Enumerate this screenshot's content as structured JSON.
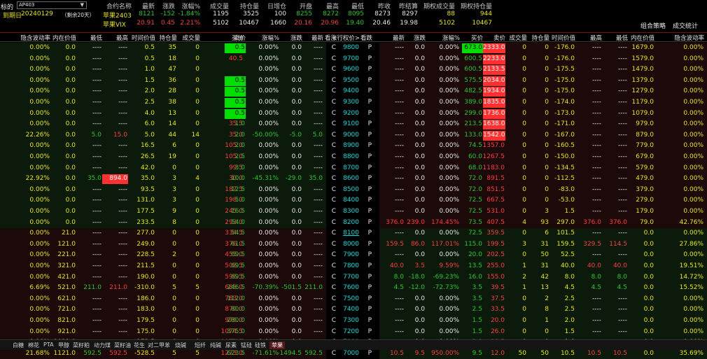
{
  "top": {
    "label_analysis": "标的",
    "product": "苹果",
    "contract_select": "AP403",
    "expiry_label": "到期日",
    "expiry_date": "20240129",
    "remaining": "（剩余20天）",
    "quote_headers": [
      "合约名称",
      "最新",
      "涨跌",
      "涨幅%",
      "成交量",
      "持仓量",
      "日增仓",
      "开盘",
      "最高",
      "最低",
      "昨收",
      "昨结算",
      "期权成交量",
      "期权持仓量"
    ],
    "quote_rows": [
      [
        "苹果2403",
        "8121",
        "-152",
        "-1.84%",
        "1195",
        "3525",
        "100",
        "8255",
        "8272",
        "8095",
        "8273",
        "8297",
        "88",
        "944"
      ],
      [
        "苹果VIX",
        "20.91",
        "0.45",
        "2.21%",
        "5102",
        "10467",
        "1660",
        "20.16",
        "20.96",
        "19.40",
        "20.46",
        "19.98",
        "5102",
        "10467"
      ]
    ],
    "btn_combo": "组合策略",
    "btn_stats": "成交统计"
  },
  "columns": {
    "call": [
      "隐含波动率",
      "内在价值",
      "最低",
      "最高",
      "时间价值",
      "持仓量",
      "成交量",
      "买价",
      "卖价",
      "涨幅%",
      "涨跌",
      "最新"
    ],
    "mid": [
      "看涨",
      "<行权价>",
      "看跌"
    ],
    "put": [
      "最新",
      "涨跌",
      "涨幅%",
      "买价",
      "卖价",
      "成交量",
      "持仓量",
      "时间价值",
      "最高",
      "最低",
      "内在价值",
      "隐含波动率"
    ]
  },
  "rows": [
    {
      "c": [
        "0.00%",
        "0.0",
        "----",
        "----",
        "0.5",
        "35",
        "0",
        "105.0",
        "0.5",
        "0.00%",
        "0.0",
        "----"
      ],
      "k": [
        "C",
        "9800",
        "P"
      ],
      "p": [
        "----",
        "0.0",
        "0.00%",
        "673.0",
        "2333.0",
        "0",
        "0",
        "-176.0",
        "----",
        "----",
        "1679.0",
        "0.00%"
      ]
    },
    {
      "c": [
        "0.00%",
        "0.0",
        "----",
        "----",
        "0.5",
        "18",
        "0",
        "40.5",
        "",
        "0.00%",
        "0.0",
        "----"
      ],
      "k": [
        "C",
        "9700",
        "P"
      ],
      "p": [
        "----",
        "0.0",
        "0.00%",
        "600.5",
        "2233.0",
        "0",
        "0",
        "-176.0",
        "----",
        "----",
        "1579.0",
        "0.00%"
      ]
    },
    {
      "c": [
        "0.00%",
        "0.0",
        "----",
        "----",
        "1.0",
        "47",
        "0",
        "",
        "",
        "0.00%",
        "0.0",
        "----"
      ],
      "k": [
        "C",
        "9600",
        "P"
      ],
      "p": [
        "----",
        "0.0",
        "0.00%",
        "600.5",
        "2133.5",
        "0",
        "0",
        "-175.5",
        "----",
        "----",
        "1479.0",
        "0.00%"
      ]
    },
    {
      "c": [
        "0.00%",
        "0.0",
        "----",
        "----",
        "1.5",
        "36",
        "0",
        "40.5",
        "0.5",
        "0.00%",
        "0.0",
        "----"
      ],
      "k": [
        "C",
        "9500",
        "P"
      ],
      "p": [
        "----",
        "0.0",
        "0.00%",
        "575.5",
        "2034.0",
        "0",
        "0",
        "-175.0",
        "----",
        "----",
        "1379.0",
        "0.00%"
      ]
    },
    {
      "c": [
        "0.00%",
        "0.0",
        "----",
        "----",
        "2.0",
        "28",
        "0",
        "35.5",
        "0.5",
        "0.00%",
        "0.0",
        "----"
      ],
      "k": [
        "C",
        "9400",
        "P"
      ],
      "p": [
        "----",
        "0.0",
        "0.00%",
        "482.5",
        "1934.0",
        "0",
        "0",
        "-175.0",
        "----",
        "----",
        "1279.0",
        "0.00%"
      ]
    },
    {
      "c": [
        "0.00%",
        "0.0",
        "----",
        "----",
        "2.5",
        "38",
        "0",
        "110.5",
        "0.5",
        "0.00%",
        "0.0",
        "----"
      ],
      "k": [
        "C",
        "9300",
        "P"
      ],
      "p": [
        "----",
        "0.0",
        "0.00%",
        "389.0",
        "1835.0",
        "0",
        "0",
        "-174.0",
        "----",
        "----",
        "1179.0",
        "0.00%"
      ]
    },
    {
      "c": [
        "0.00%",
        "0.0",
        "----",
        "----",
        "4.0",
        "13",
        "0",
        "35.0",
        "0.5",
        "0.00%",
        "0.0",
        "----"
      ],
      "k": [
        "C",
        "9200",
        "P"
      ],
      "p": [
        "----",
        "0.0",
        "0.00%",
        "299.0",
        "1736.0",
        "0",
        "0",
        "-173.0",
        "----",
        "----",
        "1079.0",
        "0.00%"
      ]
    },
    {
      "c": [
        "0.00%",
        "0.0",
        "----",
        "----",
        "6.0",
        "14",
        "0",
        "35.5",
        "1.0",
        "0.00%",
        "0.0",
        "----"
      ],
      "k": [
        "C",
        "9100",
        "P"
      ],
      "p": [
        "----",
        "0.0",
        "0.00%",
        "213.5",
        "1638.0",
        "0",
        "0",
        "-171.0",
        "----",
        "----",
        "979.0",
        "0.00%"
      ]
    },
    {
      "c": [
        "22.26%",
        "0.0",
        "5.0",
        "15.0",
        "5.0",
        "44",
        "14",
        "35.0",
        "2.0",
        "-50.00%",
        "-5.0",
        "5.0"
      ],
      "k": [
        "C",
        "9000",
        "P"
      ],
      "p": [
        "----",
        "0.0",
        "0.00%",
        "133.0",
        "1542.0",
        "0",
        "0",
        "-167.0",
        "----",
        "----",
        "879.0",
        "0.00%"
      ]
    },
    {
      "c": [
        "0.00%",
        "0.0",
        "----",
        "----",
        "16.5",
        "6",
        "0",
        "105.0",
        "2.0",
        "0.00%",
        "0.0",
        "----"
      ],
      "k": [
        "C",
        "8900",
        "P"
      ],
      "p": [
        "----",
        "0.0",
        "0.00%",
        "74.5",
        "1357.0",
        "0",
        "0",
        "-160.5",
        "----",
        "----",
        "779.0",
        "0.00%"
      ]
    },
    {
      "c": [
        "0.00%",
        "0.0",
        "----",
        "----",
        "26.5",
        "19",
        "0",
        "105.0",
        "2.5",
        "0.00%",
        "0.0",
        "----"
      ],
      "k": [
        "C",
        "8800",
        "P"
      ],
      "p": [
        "----",
        "0.0",
        "0.00%",
        "60.0",
        "1267.5",
        "0",
        "0",
        "-150.0",
        "----",
        "----",
        "679.0",
        "0.00%"
      ]
    },
    {
      "c": [
        "0.00%",
        "0.0",
        "----",
        "----",
        "42.0",
        "0",
        "0",
        "99.5",
        "3.0",
        "0.00%",
        "0.0",
        "----"
      ],
      "k": [
        "C",
        "8700",
        "P"
      ],
      "p": [
        "----",
        "0.0",
        "0.00%",
        "68.0",
        "1183.0",
        "0",
        "0",
        "-134.5",
        "----",
        "----",
        "579.0",
        "0.00%"
      ]
    },
    {
      "c": [
        "22.92%",
        "0.0",
        "35.0",
        "894.0",
        "35.0",
        "3",
        "4",
        "30.0",
        "10.0",
        "-45.31%",
        "-29.0",
        "35.0"
      ],
      "k": [
        "C",
        "8600",
        "P"
      ],
      "p": [
        "----",
        "0.0",
        "0.00%",
        "72.0",
        "891.5",
        "0",
        "0",
        "-112.5",
        "----",
        "----",
        "479.0",
        "0.00%"
      ]
    },
    {
      "c": [
        "0.00%",
        "0.0",
        "----",
        "----",
        "93.5",
        "3",
        "0",
        "187.5",
        "12.5",
        "0.00%",
        "0.0",
        "----"
      ],
      "k": [
        "C",
        "8500",
        "P"
      ],
      "p": [
        "----",
        "0.0",
        "0.00%",
        "72.0",
        "851.5",
        "0",
        "0",
        "-83.0",
        "----",
        "----",
        "379.0",
        "0.00%"
      ]
    },
    {
      "c": [
        "0.00%",
        "0.0",
        "----",
        "----",
        "131.0",
        "3",
        "0",
        "198.0",
        "5.0",
        "0.00%",
        "0.0",
        "----"
      ],
      "k": [
        "C",
        "8400",
        "P"
      ],
      "p": [
        "----",
        "0.0",
        "0.00%",
        "72.5",
        "667.5",
        "0",
        "0",
        "-53.0",
        "----",
        "----",
        "279.0",
        "0.00%"
      ]
    },
    {
      "c": [
        "0.00%",
        "0.0",
        "----",
        "----",
        "177.5",
        "9",
        "0",
        "245.0",
        "16.5",
        "0.00%",
        "0.0",
        "----"
      ],
      "k": [
        "C",
        "8300",
        "P"
      ],
      "p": [
        "----",
        "0.0",
        "0.00%",
        "72.5",
        "531.0",
        "0",
        "3",
        "1.5",
        "----",
        "----",
        "179.0",
        "0.00%"
      ]
    },
    {
      "c": [
        "0.00%",
        "0.0",
        "----",
        "----",
        "233.5",
        "8",
        "0",
        "293.0",
        "54.0",
        "0.00%",
        "0.0",
        "----"
      ],
      "k": [
        "C",
        "8200",
        "P"
      ],
      "p": [
        "376.0",
        "239.0",
        "174.45%",
        "73.5",
        "407.5",
        "4",
        "93",
        "297.0",
        "376.0",
        "376.0",
        "79.0",
        "42.76%"
      ]
    },
    {
      "c": [
        "0.00%",
        "21.0",
        "----",
        "----",
        "277.0",
        "0",
        "0",
        "334.5",
        "54.5",
        "0.00%",
        "0.0",
        "----"
      ],
      "k": [
        "C",
        "8100",
        "P"
      ],
      "p": [
        "----",
        "0.0",
        "0.00%",
        "72.5",
        "359.5",
        "0",
        "6",
        "101.5",
        "----",
        "----",
        "0.0",
        "0.00%"
      ]
    },
    {
      "c": [
        "0.00%",
        "121.0",
        "----",
        "----",
        "249.0",
        "0",
        "0",
        "376.0",
        "61.5",
        "0.00%",
        "0.0",
        "----"
      ],
      "k": [
        "C",
        "8000",
        "P"
      ],
      "p": [
        "159.5",
        "86.0",
        "117.01%",
        "115.0",
        "199.5",
        "3",
        "31",
        "159.5",
        "329.5",
        "114.5",
        "0.0",
        "27.86%"
      ]
    },
    {
      "c": [
        "0.00%",
        "221.0",
        "----",
        "----",
        "228.5",
        "2",
        "0",
        "455.0",
        "69.5",
        "0.00%",
        "0.0",
        "----"
      ],
      "k": [
        "C",
        "7900",
        "P"
      ],
      "p": [
        "----",
        "0.0",
        "0.00%",
        "20.0",
        "202.5",
        "0",
        "50",
        "52.5",
        "----",
        "----",
        "0.0",
        "0.00%"
      ]
    },
    {
      "c": [
        "0.00%",
        "321.0",
        "----",
        "----",
        "211.5",
        "0",
        "0",
        "508.5",
        "69.5",
        "0.00%",
        "0.0",
        "----"
      ],
      "k": [
        "C",
        "7800",
        "P"
      ],
      "p": [
        "40.0",
        "3.5",
        "9.59%",
        "13.5",
        "255.0",
        "1",
        "31",
        "40.0",
        "40.0",
        "40.0",
        "0.0",
        "19.51%"
      ]
    },
    {
      "c": [
        "0.00%",
        "421.0",
        "----",
        "----",
        "190.0",
        "0",
        "0",
        "596.5",
        "69.5",
        "0.00%",
        "0.0",
        "----"
      ],
      "k": [
        "C",
        "7700",
        "P"
      ],
      "p": [
        "8.0",
        "-18.0",
        "-69.23%",
        "16.0",
        "155.0",
        "2",
        "42",
        "8.0",
        "8.0",
        "8.0",
        "0.0",
        "14.72%"
      ]
    },
    {
      "c": [
        "6.69%",
        "521.0",
        "211.0",
        "211.0",
        "-310.0",
        "5",
        "5",
        "688.0",
        "246.5",
        "-70.39%",
        "-501.5",
        "211.0"
      ],
      "k": [
        "C",
        "7600",
        "P"
      ],
      "p": [
        "4.5",
        "-12.0",
        "-72.73%",
        "3.5",
        "39.5",
        "1",
        "13",
        "4.5",
        "4.5",
        "4.5",
        "0.0",
        "15.52%"
      ]
    },
    {
      "c": [
        "0.00%",
        "621.0",
        "----",
        "----",
        "186.0",
        "0",
        "0",
        "783.0",
        "112.0",
        "0.00%",
        "0.0",
        "----"
      ],
      "k": [
        "C",
        "7500",
        "P"
      ],
      "p": [
        "----",
        "0.0",
        "0.00%",
        "3.5",
        "37.5",
        "0",
        "2",
        "2.5",
        "----",
        "----",
        "0.0",
        "0.00%"
      ]
    },
    {
      "c": [
        "0.00%",
        "721.0",
        "----",
        "----",
        "183.0",
        "0",
        "0",
        "870.0",
        "80.0",
        "0.00%",
        "0.0",
        "----"
      ],
      "k": [
        "C",
        "7400",
        "P"
      ],
      "p": [
        "----",
        "0.0",
        "0.00%",
        "2.5",
        "33.5",
        "0",
        "8",
        "2.5",
        "----",
        "----",
        "0.0",
        "0.00%"
      ]
    },
    {
      "c": [
        "0.00%",
        "821.0",
        "----",
        "----",
        "179.5",
        "0",
        "0",
        "976.0",
        "280.0",
        "0.00%",
        "0.0",
        "----"
      ],
      "k": [
        "C",
        "7300",
        "P"
      ],
      "p": [
        "----",
        "0.0",
        "0.00%",
        "1.5",
        "20.0",
        "0",
        "1",
        "2.0",
        "----",
        "----",
        "0.0",
        "0.00%"
      ]
    },
    {
      "c": [
        "0.00%",
        "921.0",
        "----",
        "----",
        "175.0",
        "0",
        "0",
        "1074.5",
        "375.0",
        "0.00%",
        "0.0",
        "----"
      ],
      "k": [
        "C",
        "7200",
        "P"
      ],
      "p": [
        "----",
        "0.0",
        "0.00%",
        "1.5",
        "26.0",
        "0",
        "0",
        "1.5",
        "----",
        "----",
        "0.0",
        "0.00%"
      ]
    },
    {
      "c": [
        "0.00%",
        "1021.0",
        "----",
        "----",
        "173.5",
        "0",
        "0",
        "1173.5",
        "470.0",
        "0.00%",
        "0.0",
        "----"
      ],
      "k": [
        "C",
        "7100",
        "P"
      ],
      "p": [
        "----",
        "0.0",
        "0.00%",
        "1.0",
        "20.5",
        "0",
        "0",
        "1.0",
        "----",
        "----",
        "0.0",
        "0.00%"
      ]
    },
    {
      "c": [
        "21.68%",
        "1121.0",
        "592.5",
        "592.5",
        "-528.5",
        "5",
        "5",
        "1273.0",
        "623.5",
        "-71.61%",
        "-1494.5",
        "592.5"
      ],
      "k": [
        "C",
        "7000",
        "P"
      ],
      "p": [
        "10.5",
        "9.5",
        "950.00%",
        "9.5",
        "12.0",
        "50",
        "50",
        "10.5",
        "10.5",
        "10.5",
        "0.0",
        "35.69%"
      ]
    }
  ],
  "tabs": [
    "白糖",
    "棉花",
    "PTA",
    "甲醇",
    "菜籽粕",
    "动力煤",
    "菜籽油",
    "花生",
    "对二甲苯",
    "烧碱",
    "短纤",
    "纯碱",
    "尿素",
    "锰硅",
    "硅铁",
    "苹果"
  ],
  "active_tab": "苹果",
  "colors": {
    "bg": "#000000",
    "up": "#ff3c3c",
    "down": "#28c828",
    "itm_call_bg": "#0c1a0c",
    "itm_put_bg": "#1c0909",
    "highlight_green": "#00e000",
    "highlight_red": "#ff3030"
  }
}
